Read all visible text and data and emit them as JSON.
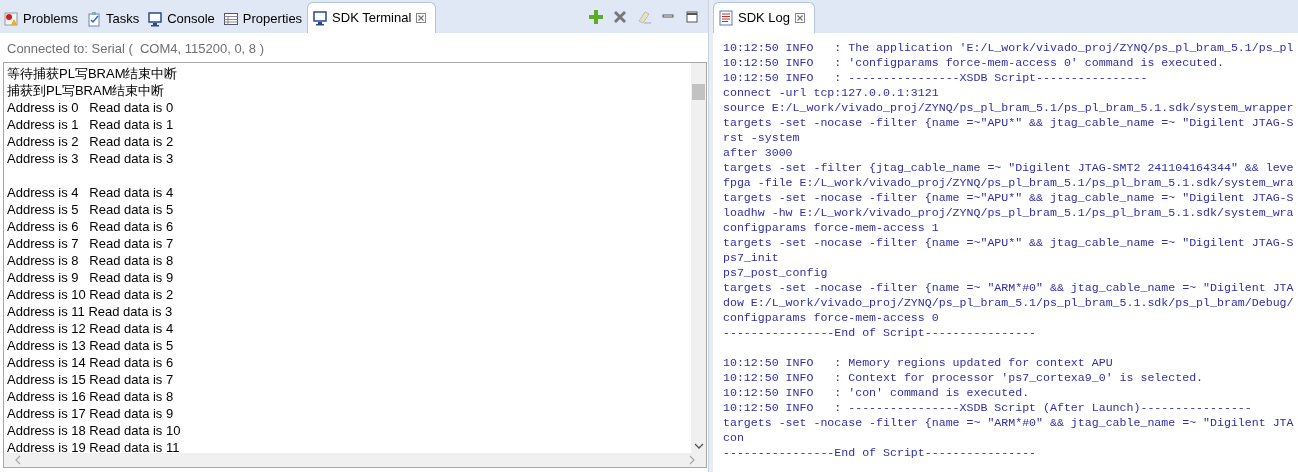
{
  "terminal_view": {
    "tabs": [
      {
        "label": "Problems",
        "selected": false,
        "closable": false
      },
      {
        "label": "Tasks",
        "selected": false,
        "closable": false
      },
      {
        "label": "Console",
        "selected": false,
        "closable": false
      },
      {
        "label": "Properties",
        "selected": false,
        "closable": false
      },
      {
        "label": "SDK Terminal",
        "selected": true,
        "closable": true
      }
    ],
    "connection": "Connected to: Serial (  COM4, 115200, 0, 8 )",
    "blocks": [
      [
        "等待捕获PL写BRAM结束中断",
        "捕获到PL写BRAM结束中断",
        "Address is 0   Read data is 0",
        "Address is 1   Read data is 1",
        "Address is 2   Read data is 2",
        "Address is 3   Read data is 3"
      ],
      [
        "Address is 4   Read data is 4",
        "Address is 5   Read data is 5",
        "Address is 6   Read data is 6",
        "Address is 7   Read data is 7",
        "Address is 8   Read data is 8",
        "Address is 9   Read data is 9",
        "Address is 10 Read data is 2",
        "Address is 11 Read data is 3",
        "Address is 12 Read data is 4",
        "Address is 13 Read data is 5",
        "Address is 14 Read data is 6",
        "Address is 15 Read data is 7",
        "Address is 16 Read data is 8",
        "Address is 17 Read data is 9",
        "Address is 18 Read data is 10",
        "Address is 19 Read data is 11"
      ]
    ]
  },
  "log_view": {
    "tabs": [
      {
        "label": "SDK Log",
        "selected": true,
        "closable": true
      }
    ],
    "blocks": [
      [
        "10:12:50 INFO   : The application 'E:/L_work/vivado_proj/ZYNQ/ps_pl_bram_5.1/ps_pl",
        "10:12:50 INFO   : 'configparams force-mem-access 0' command is executed.",
        "10:12:50 INFO   : ----------------XSDB Script----------------",
        "connect -url tcp:127.0.0.1:3121",
        "source E:/L_work/vivado_proj/ZYNQ/ps_pl_bram_5.1/ps_pl_bram_5.1.sdk/system_wrapper",
        "targets -set -nocase -filter {name =~\"APU*\" && jtag_cable_name =~ \"Digilent JTAG-S",
        "rst -system",
        "after 3000",
        "targets -set -filter {jtag_cable_name =~ \"Digilent JTAG-SMT2 241104164344\" && leve",
        "fpga -file E:/L_work/vivado_proj/ZYNQ/ps_pl_bram_5.1/ps_pl_bram_5.1.sdk/system_wra",
        "targets -set -nocase -filter {name =~\"APU*\" && jtag_cable_name =~ \"Digilent JTAG-S",
        "loadhw -hw E:/L_work/vivado_proj/ZYNQ/ps_pl_bram_5.1/ps_pl_bram_5.1.sdk/system_wra",
        "configparams force-mem-access 1",
        "targets -set -nocase -filter {name =~\"APU*\" && jtag_cable_name =~ \"Digilent JTAG-S",
        "ps7_init",
        "ps7_post_config",
        "targets -set -nocase -filter {name =~ \"ARM*#0\" && jtag_cable_name =~ \"Digilent JTA",
        "dow E:/L_work/vivado_proj/ZYNQ/ps_pl_bram_5.1/ps_pl_bram_5.1.sdk/ps_pl_bram/Debug/",
        "configparams force-mem-access 0",
        "----------------End of Script----------------"
      ],
      [
        "10:12:50 INFO   : Memory regions updated for context APU",
        "10:12:50 INFO   : Context for processor 'ps7_cortexa9_0' is selected.",
        "10:12:50 INFO   : 'con' command is executed.",
        "10:12:50 INFO   : ----------------XSDB Script (After Launch)----------------",
        "targets -set -nocase -filter {name =~ \"ARM*#0\" && jtag_cable_name =~ \"Digilent JTA",
        "con",
        "----------------End of Script----------------"
      ]
    ]
  }
}
